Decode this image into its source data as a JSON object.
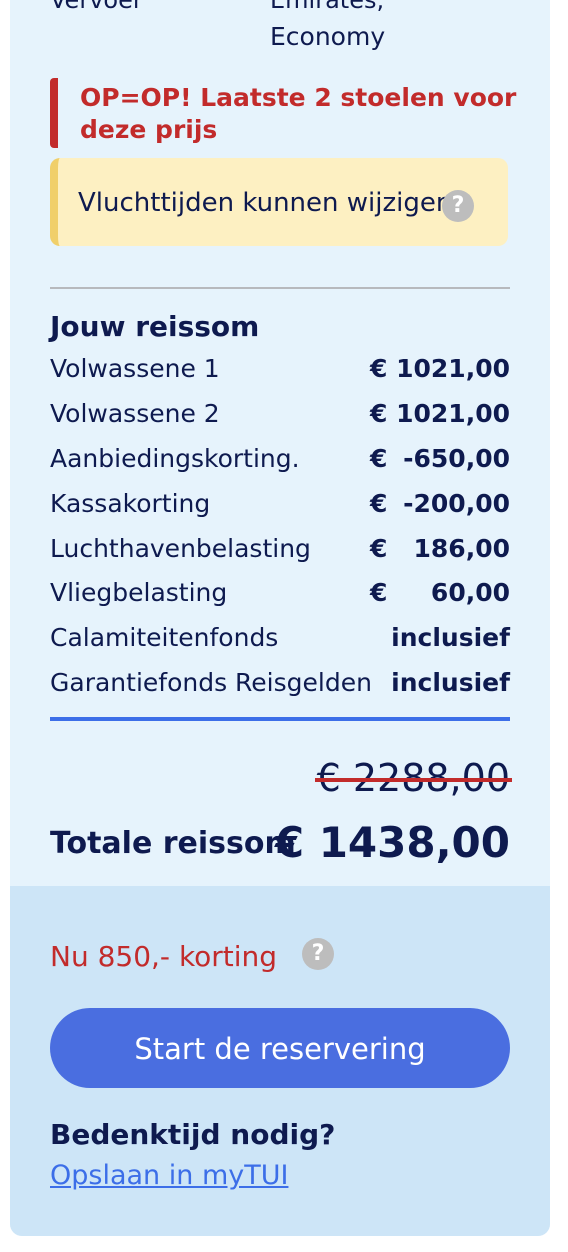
{
  "flight_info": {
    "cutoff_label": "Vervoer",
    "cutoff_value": "Emirates,",
    "class": "Economy"
  },
  "alert": {
    "text": "OP=OP! Laatste 2 stoelen voor deze prijs"
  },
  "notice": {
    "text": "Vluchttijden kunnen wijzigen",
    "help_glyph": "?"
  },
  "summary": {
    "title": "Jouw reissom",
    "items": [
      {
        "label": "Volwassene 1",
        "currency": "€",
        "amount": "1021,00"
      },
      {
        "label": "Volwassene 2",
        "currency": "€",
        "amount": "1021,00"
      },
      {
        "label": "Aanbiedingskorting.",
        "currency": "€",
        "amount": "-650,00"
      },
      {
        "label": "Kassakorting",
        "currency": "€",
        "amount": "-200,00"
      },
      {
        "label": "Luchthavenbelasting",
        "currency": "€",
        "amount": "186,00"
      },
      {
        "label": "Vliegbelasting",
        "currency": "€",
        "amount": "60,00"
      },
      {
        "label": "Calamiteitenfonds",
        "currency": "",
        "amount": "inclusief"
      },
      {
        "label": "Garantiefonds Reisgelden",
        "currency": "",
        "amount": "inclusief"
      }
    ],
    "old_price": "€ 2288,00",
    "total_label": "Totale reissom",
    "total_price": "€ 1438,00"
  },
  "footer": {
    "discount_text": "Nu 850,- korting",
    "help_glyph": "?",
    "cta_label": "Start de reservering",
    "think_title": "Bedenktijd nodig?",
    "save_link": "Opslaan in myTUI"
  },
  "colors": {
    "accent": "#4a6ee0",
    "alert_red": "#c22b2b",
    "notice_bg": "#fdf0c2",
    "card_bg": "#e6f3fc",
    "footer_bg": "#cde5f7"
  },
  "icons": {
    "help": "question-circle-icon"
  }
}
